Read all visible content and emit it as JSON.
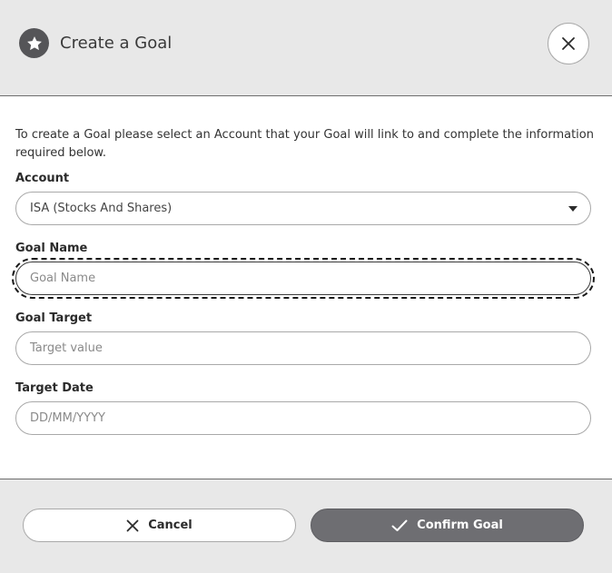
{
  "header": {
    "title": "Create a Goal",
    "icon": "star-icon",
    "close_icon": "close-icon"
  },
  "intro_text": "To create a Goal please select an Account that your Goal will link to and complete the information required below.",
  "form": {
    "account": {
      "label": "Account",
      "value": "ISA (Stocks And Shares)"
    },
    "goal_name": {
      "label": "Goal Name",
      "value": "",
      "placeholder": "Goal Name"
    },
    "goal_target": {
      "label": "Goal Target",
      "value": "",
      "placeholder": "Target value"
    },
    "target_date": {
      "label": "Target Date",
      "value": "",
      "placeholder": "DD/MM/YYYY"
    }
  },
  "footer": {
    "cancel_label": "Cancel",
    "confirm_label": "Confirm Goal"
  },
  "colors": {
    "header_bg": "#e8e8e8",
    "icon_dark": "#555558",
    "confirm_bg": "#6e6e72",
    "border": "#a9a9a9"
  }
}
